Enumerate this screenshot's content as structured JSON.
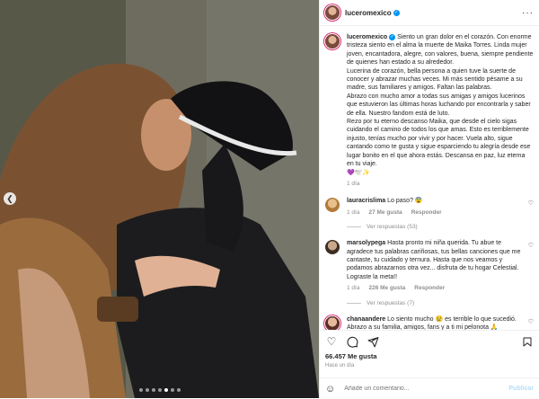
{
  "post": {
    "username": "luceromexico",
    "caption": "Siento un gran dolor en el corazón. Con enorme tristeza siento en el alma la muerte de Maika Torres. Linda mujer joven, encantadora, alegre, con valores, buena, siempre pendiente de quienes han estado a su alrededor.",
    "caption_p2": "Lucerina de corazón, bella persona a quien tuve la suerte de conocer y abrazar muchas veces. Mi más sentido pésame a su madre, sus familiares y amigos. Faltan las palabras.",
    "caption_p3": "Abrazo con mucho amor a todas sus amigas y amigos lucerinos que estuvieron las últimas horas luchando por encontrarla y saber de ella. Nuestro fandom está de luto.",
    "caption_p4": "Rezo por tu eterno descanso Maika, que desde el cielo sigas cuidando el camino de todos los que amas. Esto es terriblemente injusto, tenías mucho por vivir y por hacer. Vuela alto, sigue cantando como te gusta y sigue esparciendo tu alegría desde ese lugar bonito en el que ahora estás. Descansa en paz, luz eterna en tu viaje.",
    "caption_emoji": "💜🕊️✨",
    "age": "1 día"
  },
  "comments": [
    {
      "username": "lauracrislima",
      "text": "Lo paso?",
      "emoji": "😨",
      "age": "1 día",
      "likes": "27 Me gusta",
      "reply": "Responder",
      "replies": "Ver respuestas (53)"
    },
    {
      "username": "marsolypega",
      "text": "Hasta pronto mi niña querida. Tu abue te agradece tus palabras cariñosas, tus bellas canciones que me cantaste, tu cuidado y ternura. Hasta que nos veamos y podamos abrazarnos otra vez... disfruta de tu hogar Celestial. Lograste la meta!!",
      "emoji": "",
      "age": "1 día",
      "likes": "226 Me gusta",
      "reply": "Responder",
      "replies": "Ver respuestas (7)"
    },
    {
      "username": "chanaandere",
      "text": "Lo siento mucho 😢 es terrible lo que sucedió. Abrazo a su familia, amigos, fans y a ti mi pelonota 🙏",
      "emoji": "",
      "age": "",
      "likes": "",
      "reply": "",
      "replies": ""
    }
  ],
  "footer": {
    "likes": "66.457 Me gusta",
    "time": "Hace un día",
    "add_placeholder": "Añade un comentario...",
    "post_label": "Publicar"
  },
  "icons": {
    "like": "heart-icon",
    "comment": "comment-icon",
    "share": "share-icon",
    "save": "bookmark-icon",
    "emoji": "smiley-icon",
    "more": "more-icon"
  },
  "colors": {
    "verified": "#0095f6",
    "post_btn": "#b2dffc",
    "muted": "#8e8e8e"
  }
}
